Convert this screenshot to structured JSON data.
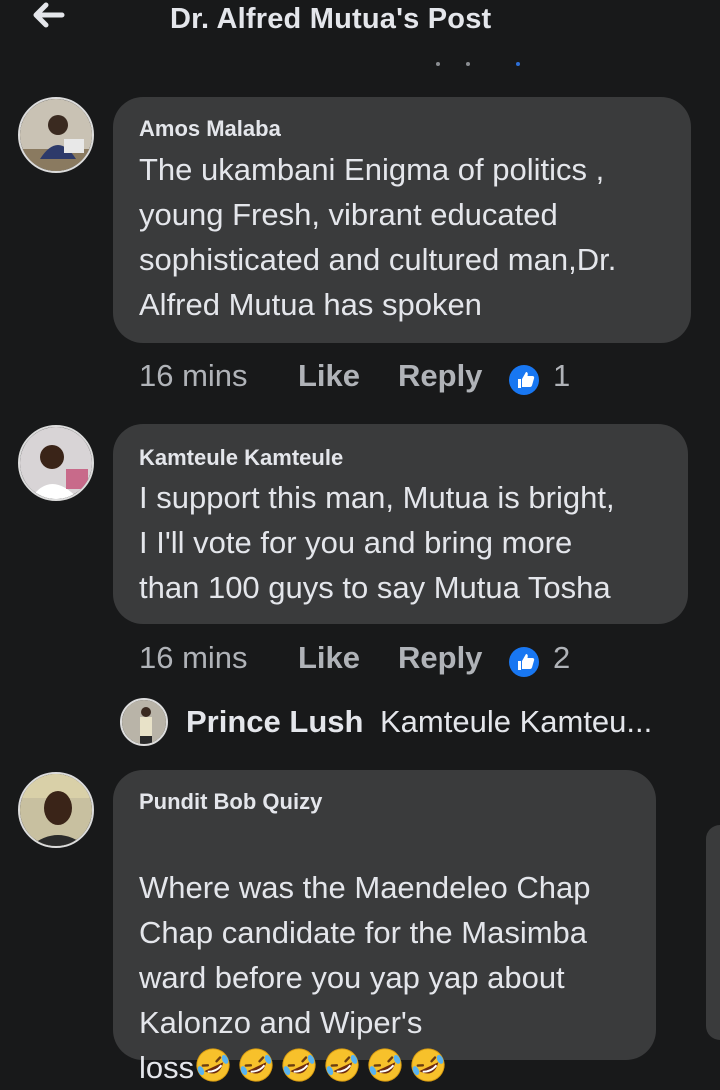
{
  "header": {
    "title": "Dr. Alfred Mutua's Post",
    "back_icon": "arrow-left-icon"
  },
  "colors": {
    "background": "#18191a",
    "bubble": "#3a3b3c",
    "text": "#e4e6eb",
    "muted": "#b0b3b8",
    "like_blue": "#1877f2"
  },
  "comments": [
    {
      "author": "Amos Malaba",
      "text": "The ukambani Enigma of politics ,\nyoung Fresh, vibrant educated\nsophisticated and cultured man,Dr.\nAlfred Mutua has spoken",
      "time": "16 mins",
      "like_label": "Like",
      "reply_label": "Reply",
      "reaction_count": "1",
      "reaction_icon": "thumbs-up-icon"
    },
    {
      "author": "Kamteule Kamteule",
      "text": "I support this man, Mutua is bright,\nI I'll vote for you and bring more\nthan 100 guys to say Mutua Tosha",
      "time": "16 mins",
      "like_label": "Like",
      "reply_label": "Reply",
      "reaction_count": "2",
      "reaction_icon": "thumbs-up-icon",
      "reply_preview": {
        "author": "Prince Lush",
        "snippet": "Kamteule Kamteu..."
      }
    },
    {
      "author": "Pundit Bob Quizy",
      "text": "Where was the Maendeleo Chap\nChap candidate for the Masimba\nward before you yap yap about\nKalonzo and Wiper's",
      "text_last": "loss",
      "emoji_icon": "rolling-on-floor-laughing-emoji-icon",
      "emoji_count": 6
    }
  ]
}
